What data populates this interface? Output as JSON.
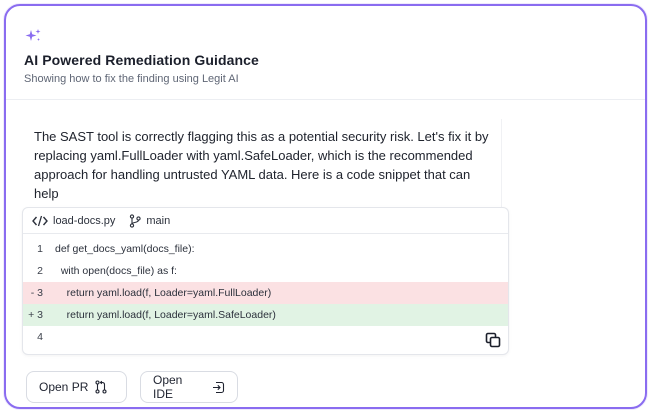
{
  "header": {
    "icon": "sparkle-icon",
    "title": "AI Powered Remediation Guidance",
    "subtitle": "Showing how to fix the finding using Legit AI"
  },
  "explanation": "The SAST tool is correctly flagging this as a potential security risk. Let's fix it by replacing yaml.FullLoader with yaml.SafeLoader, which is the recommended approach for handling untrusted YAML data. Here is a code snippet that can help",
  "code": {
    "file_icon": "code-icon",
    "filename": "load-docs.py",
    "branch_icon": "git-branch-icon",
    "branch": "main",
    "lines": [
      {
        "num": "1",
        "type": "context",
        "text": "def get_docs_yaml(docs_file):"
      },
      {
        "num": "2",
        "type": "context",
        "text": "  with open(docs_file) as f:"
      },
      {
        "num": "- 3",
        "type": "removed",
        "text": "    return yaml.load(f, Loader=yaml.FullLoader)"
      },
      {
        "num": "+ 3",
        "type": "added",
        "text": "    return yaml.load(f, Loader=yaml.SafeLoader)"
      },
      {
        "num": "4",
        "type": "context",
        "text": ""
      }
    ],
    "copy_icon": "copy-icon"
  },
  "actions": {
    "open_pr": "Open PR",
    "open_pr_icon": "pull-request-icon",
    "open_ide": "Open IDE",
    "open_ide_icon": "open-external-icon"
  },
  "colors": {
    "accent": "#8a6cf0",
    "removed_bg": "#fbe1e3",
    "added_bg": "#e1f3e4"
  }
}
